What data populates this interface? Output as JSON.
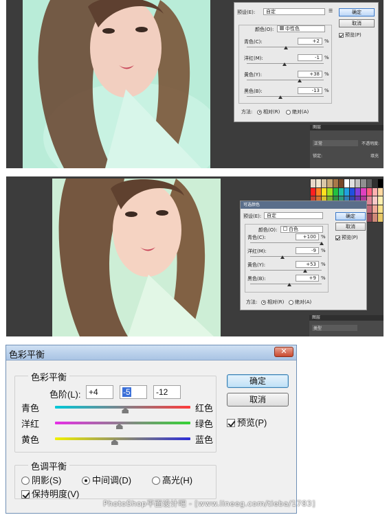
{
  "selective_color_1": {
    "preset_label": "预设(E):",
    "preset_value": "自定",
    "color_label": "颜色(O):",
    "color_value": "中性色",
    "ok": "确定",
    "cancel": "取消",
    "preview": "预览(P)",
    "rows": [
      {
        "label": "青色(C):",
        "value": "+2",
        "unit": "%",
        "level": 0.51
      },
      {
        "label": "洋红(M):",
        "value": "-1",
        "unit": "%",
        "level": 0.495
      },
      {
        "label": "黄色(Y):",
        "value": "+38",
        "unit": "%",
        "level": 0.69
      },
      {
        "label": "黑色(B):",
        "value": "-13",
        "unit": "%",
        "level": 0.435
      }
    ],
    "method_label": "方法:",
    "relative": "相对(R)",
    "absolute": "绝对(A)",
    "layers_tab": "图层",
    "layers_kind": "正常",
    "opacity_label": "不透明度:",
    "lock_label": "锁定:",
    "fill_label": "填充"
  },
  "selective_color_2": {
    "title": "可选颜色",
    "preset_label": "预设(E):",
    "preset_value": "自定",
    "color_label": "颜色(O):",
    "color_value": "白色",
    "ok": "确定",
    "cancel": "取消",
    "preview": "预览(P)",
    "rows": [
      {
        "label": "青色(C):",
        "value": "+100",
        "unit": "%",
        "level": 1.0
      },
      {
        "label": "洋红(M):",
        "value": "-9",
        "unit": "%",
        "level": 0.455
      },
      {
        "label": "黄色(Y):",
        "value": "+53",
        "unit": "%",
        "level": 0.765
      },
      {
        "label": "黑色(B):",
        "value": "+9",
        "unit": "%",
        "level": 0.545
      }
    ],
    "method_label": "方法:",
    "relative": "相对(R)",
    "absolute": "绝对(A)",
    "layers_tab": "图层",
    "layers_kind": "类型"
  },
  "color_balance": {
    "title": "色彩平衡",
    "close": "✕",
    "group_title": "色彩平衡",
    "levels_label": "色阶(L):",
    "levels": [
      "+4",
      "-5",
      "-12"
    ],
    "sliders": [
      {
        "left": "青色",
        "right": "红色",
        "level": 0.52,
        "gradient": "linear-gradient(90deg,#00c8d8,#ff3b3b)"
      },
      {
        "left": "洋红",
        "right": "绿色",
        "level": 0.475,
        "gradient": "linear-gradient(90deg,#e62ee6,#35d335)"
      },
      {
        "left": "黄色",
        "right": "蓝色",
        "level": 0.44,
        "gradient": "linear-gradient(90deg,#f0f000,#2d2dd8)"
      }
    ],
    "tone_group_title": "色调平衡",
    "shadows": "阴影(S)",
    "midtones": "中间调(D)",
    "highlights": "高光(H)",
    "preserve": "保持明度(V)",
    "ok": "确定",
    "cancel": "取消",
    "preview": "预览(P)"
  },
  "watermark": "PhotoShop平面设计吧 - [www.lineeg.com/tieba/1783]"
}
